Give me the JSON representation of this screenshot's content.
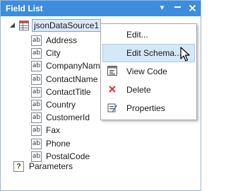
{
  "window": {
    "title": "Field List",
    "dropdown_icon": "▾",
    "pin_icon": "–",
    "close_icon": "✕"
  },
  "tree": {
    "root": {
      "label": "jsonDataSource1",
      "icon": "datasource-icon",
      "expanded": true
    },
    "field_icon_text": "ab",
    "fields": [
      "Address",
      "City",
      "CompanyName",
      "ContactName",
      "ContactTitle",
      "Country",
      "CustomerId",
      "Fax",
      "Phone",
      "PostalCode"
    ],
    "parameters": {
      "label": "Parameters",
      "icon_text": "?"
    }
  },
  "context_menu": {
    "items": [
      {
        "label": "Edit...",
        "icon": "",
        "highlighted": false
      },
      {
        "label": "Edit Schema...",
        "icon": "",
        "highlighted": true
      },
      {
        "label": "View Code",
        "icon": "code-icon",
        "highlighted": false
      },
      {
        "label": "Delete",
        "icon": "delete-icon",
        "highlighted": false
      },
      {
        "label": "Properties",
        "icon": "properties-icon",
        "highlighted": false
      }
    ]
  },
  "colors": {
    "titlebar": "#3e8ddd",
    "highlight": "#d5e8f8",
    "delete": "#d9342b"
  }
}
